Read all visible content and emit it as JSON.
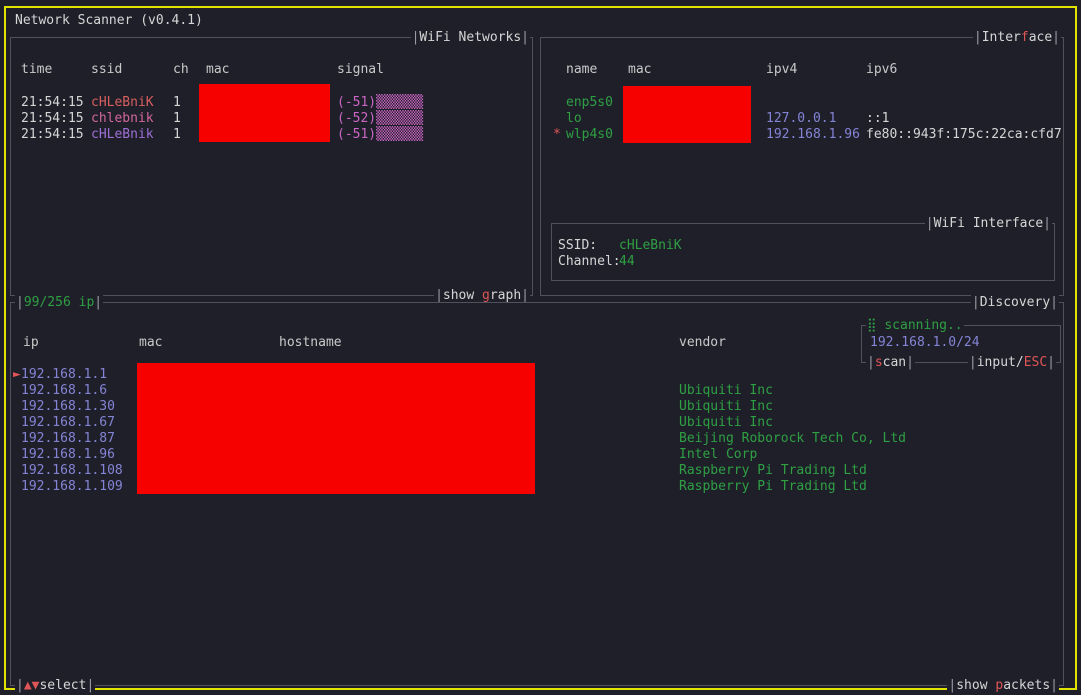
{
  "window": {
    "title": "Network Scanner (v0.4.1)"
  },
  "colors": {
    "background": "#1f1f29",
    "window_border": "#e3e300",
    "panel_border": "#51515c",
    "text": "#d6d6d6",
    "hotkey": "#e05555",
    "redaction": "#f60000",
    "green": "#2ea043",
    "purple": "#8484d6",
    "magenta": "#cc66c4"
  },
  "wifi_panel": {
    "title": {
      "open": "|",
      "text": "WiFi Networks",
      "close": "|"
    },
    "headers": {
      "time": "time",
      "ssid": "ssid",
      "ch": "ch",
      "mac": "mac",
      "signal": "signal"
    },
    "rows": [
      {
        "time": "21:54:15",
        "ssid": "cHLeBniK",
        "ssid_color": "#d75f5f",
        "ch": "1",
        "signal_db": "(-51)",
        "signal_bars": "▒▒▒▒▒▒"
      },
      {
        "time": "21:54:15",
        "ssid": "chlebnik",
        "ssid_color": "#d2679e",
        "ch": "1",
        "signal_db": "(-52)",
        "signal_bars": "▒▒▒▒▒▒"
      },
      {
        "time": "21:54:15",
        "ssid": "cHLeBnik",
        "ssid_color": "#9d6fd4",
        "ch": "1",
        "signal_db": "(-51)",
        "signal_bars": "▒▒▒▒▒▒"
      }
    ],
    "show_graph": {
      "open": "|",
      "pre": "show ",
      "key": "g",
      "post": "raph",
      "close": "|"
    }
  },
  "interface_panel": {
    "title": {
      "open": "|",
      "pre": "Inter",
      "key": "f",
      "post": "ace",
      "close": "|"
    },
    "headers": {
      "name": "name",
      "mac": "mac",
      "ipv4": "ipv4",
      "ipv6": "ipv6"
    },
    "rows": [
      {
        "marker": "",
        "name": "enp5s0",
        "ipv4": "",
        "ipv6": ""
      },
      {
        "marker": "",
        "name": "lo",
        "ipv4": "127.0.0.1",
        "ipv6": "::1"
      },
      {
        "marker": "*",
        "name": "wlp4s0",
        "ipv4": "192.168.1.96",
        "ipv6": "fe80::943f:175c:22ca:cfd7"
      }
    ],
    "wifi_interface": {
      "title": {
        "open": "|",
        "text": "WiFi Interface",
        "close": "|"
      },
      "ssid_label": "SSID:",
      "ssid_value": "cHLeBniK",
      "channel_label": "Channel:",
      "channel_value": "44"
    }
  },
  "discovery_panel": {
    "count_label": {
      "open": "|",
      "text": "99/256 ip",
      "close": "|"
    },
    "title": {
      "open": "|",
      "text": "Discovery",
      "close": "|"
    },
    "headers": {
      "ip": "ip",
      "mac": "mac",
      "hostname": "hostname",
      "vendor": "vendor"
    },
    "rows": [
      {
        "selected": "►",
        "ip": "192.168.1.1",
        "vendor": ""
      },
      {
        "selected": "",
        "ip": "192.168.1.6",
        "vendor": "Ubiquiti Inc"
      },
      {
        "selected": "",
        "ip": "192.168.1.30",
        "vendor": "Ubiquiti Inc"
      },
      {
        "selected": "",
        "ip": "192.168.1.67",
        "vendor": "Ubiquiti Inc"
      },
      {
        "selected": "",
        "ip": "192.168.1.87",
        "vendor": "Beijing Roborock Tech Co, Ltd"
      },
      {
        "selected": "",
        "ip": "192.168.1.96",
        "vendor": "Intel Corp"
      },
      {
        "selected": "",
        "ip": "192.168.1.108",
        "vendor": "Raspberry Pi Trading Ltd"
      },
      {
        "selected": "",
        "ip": "192.168.1.109",
        "vendor": "Raspberry Pi Trading Ltd"
      }
    ],
    "scan_box": {
      "spinner": "⣿",
      "status_text": " scanning..",
      "subnet": "192.168.1.0/24",
      "scan_label": {
        "open": "|",
        "key": "s",
        "post": "can",
        "close": "|"
      },
      "input_label": {
        "open": "|",
        "pre": "input/",
        "key": "ESC",
        "close": "|"
      }
    },
    "select_label": {
      "open": "|",
      "arrows": "▲▼",
      "text": "select",
      "close": "|"
    },
    "show_packets": {
      "open": "|",
      "pre": "show ",
      "key": "p",
      "post": "ackets",
      "close": "|"
    }
  }
}
